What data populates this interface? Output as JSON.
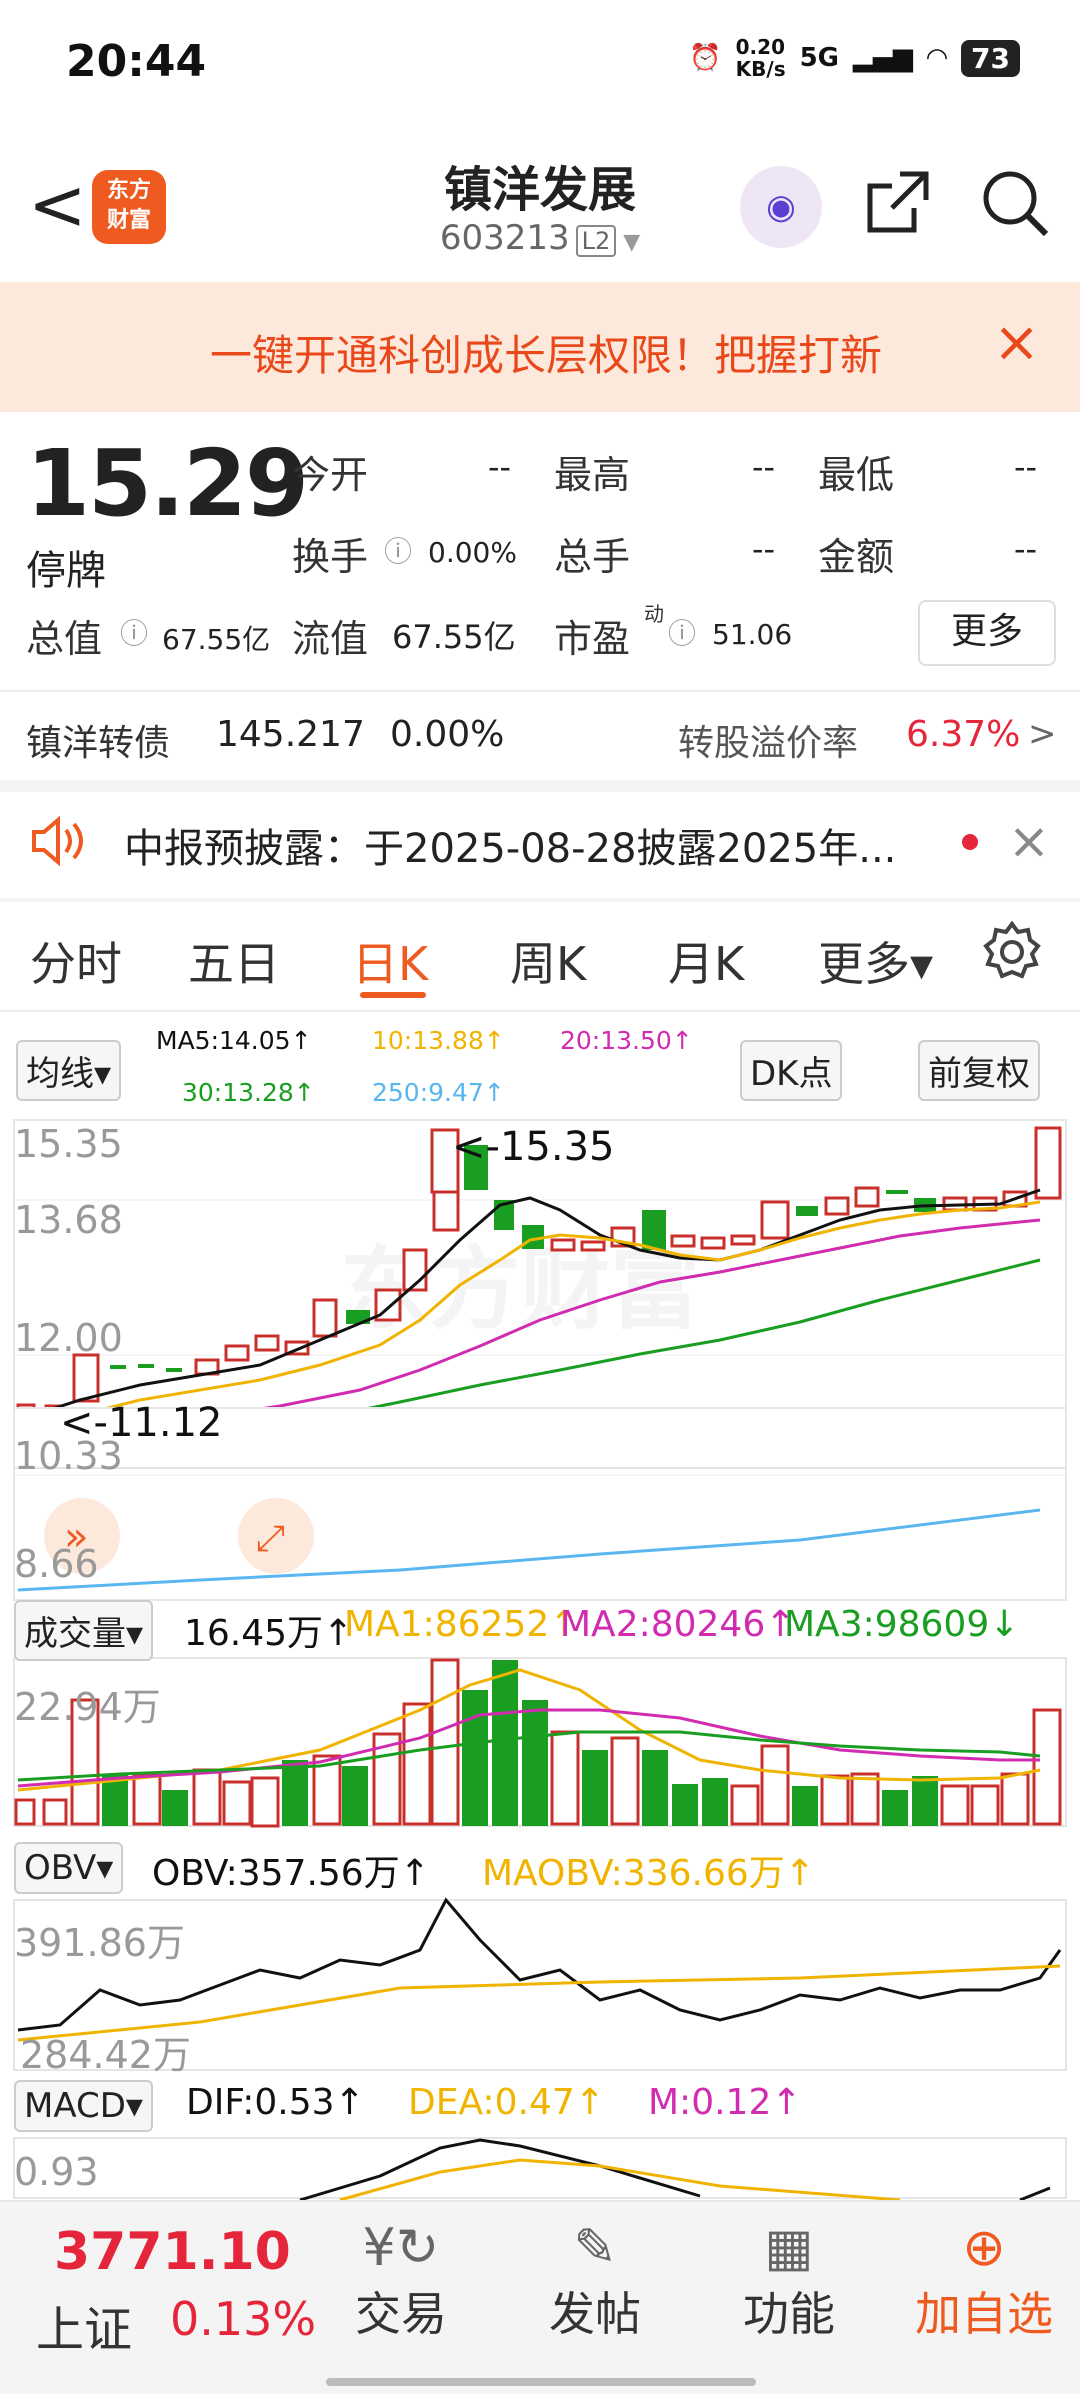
{
  "status": {
    "time": "20:44",
    "speed": "0.20\nKB/s",
    "net": "5G",
    "battery": "73"
  },
  "header": {
    "back": "<",
    "logo": "东方\n财富",
    "title": "镇洋发展",
    "code": "603213",
    "level": "L2"
  },
  "banner": {
    "text": "一键开通科创成长层权限！把握打新",
    "close": "×"
  },
  "quote": {
    "price": "15.29",
    "status": "停牌",
    "open_label": "今开",
    "open": "--",
    "high_label": "最高",
    "high": "--",
    "low_label": "最低",
    "low": "--",
    "turnover_label": "换手",
    "turnover": "0.00%",
    "volume_label": "总手",
    "volume": "--",
    "amount_label": "金额",
    "amount": "--",
    "mktcap_label": "总值",
    "mktcap": "67.55亿",
    "float_label": "流值",
    "float": "67.55亿",
    "pe_label": "市盈",
    "pe_sup": "动",
    "pe": "51.06",
    "more": "更多"
  },
  "bond": {
    "name": "镇洋转债",
    "price": "145.217",
    "change": "0.00%",
    "premium_label": "转股溢价率",
    "premium": "6.37%",
    "arrow": ">"
  },
  "notice": {
    "text": "中报预披露：于2025-08-28披露2025年...",
    "close": "×"
  },
  "tabs": [
    {
      "label": "分时"
    },
    {
      "label": "五日"
    },
    {
      "label": "日K"
    },
    {
      "label": "周K"
    },
    {
      "label": "月K"
    },
    {
      "label": "更多▾"
    }
  ],
  "legend": {
    "select": "均线▾",
    "ma5": "MA5:14.05↑",
    "ma10": "10:13.88↑",
    "ma20": "20:13.50↑",
    "ma30": "30:13.28↑",
    "ma250": "250:9.47↑",
    "dk": "DK点",
    "fq": "前复权"
  },
  "chart": {
    "yticks": [
      "15.35",
      "13.68",
      "12.00",
      "10.33",
      "8.66"
    ],
    "high_tag": "<-15.35",
    "low_tag": "<-11.12"
  },
  "volume": {
    "select": "成交量▾",
    "value": "16.45万↑",
    "ma1": "MA1:86252↑",
    "ma2": "MA2:80246↑",
    "ma3": "MA3:98609↓",
    "ytick": "22.94万"
  },
  "obv": {
    "select": "OBV▾",
    "value": "OBV:357.56万↑",
    "ma": "MAOBV:336.66万↑",
    "y1": "391.86万",
    "y2": "284.42万"
  },
  "macd": {
    "select": "MACD▾",
    "dif": "DIF:0.53↑",
    "dea": "DEA:0.47↑",
    "m": "M:0.12↑",
    "ytick": "0.93"
  },
  "bottom": {
    "index_value": "3771.10",
    "index_name": "上证",
    "index_change": "0.13%",
    "nav": [
      {
        "label": "交易"
      },
      {
        "label": "发帖"
      },
      {
        "label": "功能"
      },
      {
        "label": "加自选"
      }
    ]
  },
  "colors": {
    "up": "#e5263a",
    "down": "#1a9e22",
    "accent": "#ef5a20",
    "ma5": "#111111",
    "ma10": "#f0b400",
    "ma20": "#d12bb0",
    "ma30": "#1a9e22",
    "ma250": "#5ab6ef"
  }
}
